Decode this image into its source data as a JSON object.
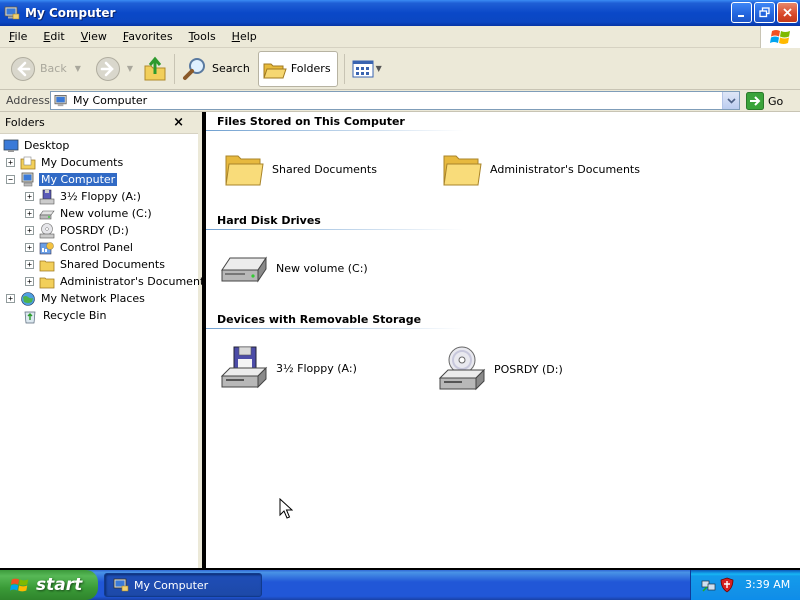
{
  "window": {
    "title": "My Computer"
  },
  "menubar": {
    "items": [
      {
        "label": "File",
        "key": "F",
        "rest": "ile"
      },
      {
        "label": "Edit",
        "key": "E",
        "rest": "dit"
      },
      {
        "label": "View",
        "key": "V",
        "rest": "iew"
      },
      {
        "label": "Favorites",
        "key": "F",
        "rest": "avorites"
      },
      {
        "label": "Tools",
        "key": "T",
        "rest": "ools"
      },
      {
        "label": "Help",
        "key": "H",
        "rest": "elp"
      }
    ]
  },
  "toolbar": {
    "back_label": "Back",
    "search_label": "Search",
    "folders_label": "Folders"
  },
  "address": {
    "label": "Address",
    "value": "My Computer",
    "go_label": "Go"
  },
  "folders_pane": {
    "title": "Folders",
    "close_glyph": "×",
    "tree": [
      {
        "label": "Desktop",
        "icon": "desktop-icon"
      },
      {
        "label": "My Documents",
        "icon": "my-documents-icon",
        "expander": "+"
      },
      {
        "label": "My Computer",
        "icon": "my-computer-icon",
        "expander": "−",
        "selected": true
      },
      {
        "label": "3½ Floppy (A:)",
        "icon": "floppy-drive-icon",
        "expander": "+"
      },
      {
        "label": "New volume (C:)",
        "icon": "hard-drive-icon",
        "expander": "+"
      },
      {
        "label": "POSRDY (D:)",
        "icon": "cd-drive-icon",
        "expander": "+"
      },
      {
        "label": "Control Panel",
        "icon": "control-panel-icon",
        "expander": "+"
      },
      {
        "label": "Shared Documents",
        "icon": "folder-icon",
        "expander": "+"
      },
      {
        "label": "Administrator's Documents",
        "icon": "folder-icon",
        "expander": "+"
      },
      {
        "label": "My Network Places",
        "icon": "network-places-icon",
        "expander": "+"
      },
      {
        "label": "Recycle Bin",
        "icon": "recycle-bin-icon"
      }
    ]
  },
  "content": {
    "groups": [
      {
        "title": "Files Stored on This Computer",
        "items": [
          {
            "label": "Shared Documents",
            "icon": "folder-icon"
          },
          {
            "label": "Administrator's Documents",
            "icon": "folder-icon"
          }
        ]
      },
      {
        "title": "Hard Disk Drives",
        "items": [
          {
            "label": "New volume (C:)",
            "icon": "hard-drive-icon"
          }
        ]
      },
      {
        "title": "Devices with Removable Storage",
        "items": [
          {
            "label": "3½ Floppy (A:)",
            "icon": "floppy-drive-icon"
          },
          {
            "label": "POSRDY (D:)",
            "icon": "cd-drive-icon"
          }
        ]
      }
    ]
  },
  "taskbar": {
    "start_label": "start",
    "task_label": "My Computer",
    "clock": "3:39 AM"
  },
  "colors": {
    "titlebar_blue": "#0a48c8",
    "selection": "#316ac5",
    "start_green": "#3a9b37",
    "chrome": "#ece9d8"
  }
}
